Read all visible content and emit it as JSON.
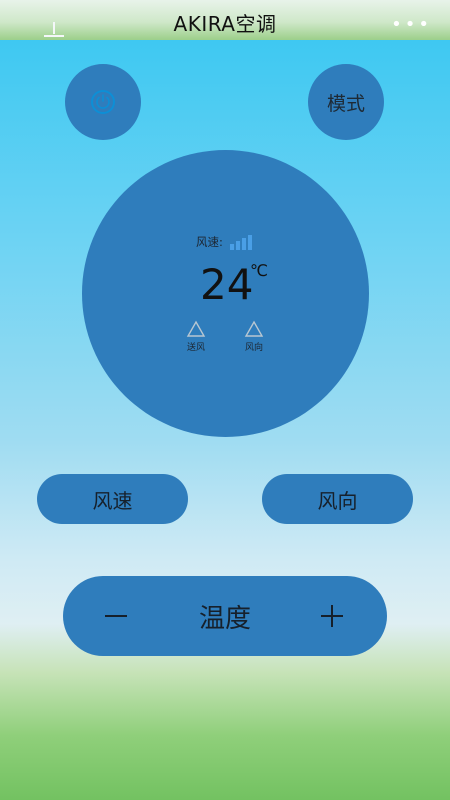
{
  "header": {
    "title": "AKIRA空调"
  },
  "buttons": {
    "mode_label": "模式"
  },
  "display": {
    "speed_label": "风速:",
    "temperature": "24",
    "unit": "℃",
    "indicators": [
      {
        "label": "送风"
      },
      {
        "label": "风向"
      }
    ]
  },
  "controls": {
    "speed_label": "风速",
    "direction_label": "风向",
    "temperature_label": "温度"
  },
  "colors": {
    "accent": "#2f7dbc",
    "speed_bars": "#4a9fe6"
  }
}
